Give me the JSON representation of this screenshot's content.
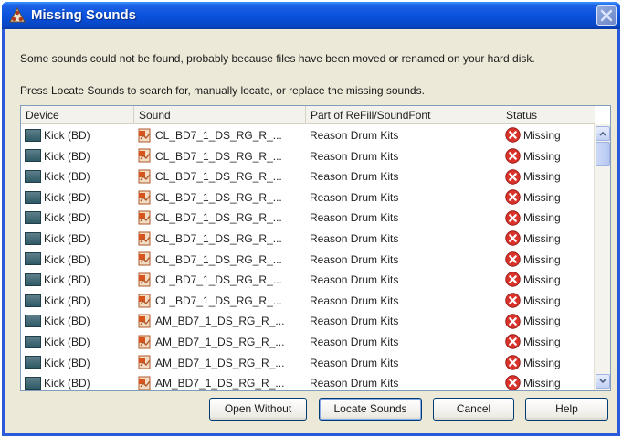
{
  "window": {
    "title": "Missing Sounds"
  },
  "messages": {
    "line1": "Some sounds could not be found, probably because files have been moved or renamed on your hard disk.",
    "line2": "Press Locate Sounds to search for, manually locate, or replace the missing sounds."
  },
  "table": {
    "columns": [
      "Device",
      "Sound",
      "Part of ReFill/SoundFont",
      "Status"
    ],
    "rows": [
      {
        "device": "Kick (BD)",
        "sound": "CL_BD7_1_DS_RG_R_...",
        "part": "Reason Drum Kits",
        "status": "Missing"
      },
      {
        "device": "Kick (BD)",
        "sound": "CL_BD7_1_DS_RG_R_...",
        "part": "Reason Drum Kits",
        "status": "Missing"
      },
      {
        "device": "Kick (BD)",
        "sound": "CL_BD7_1_DS_RG_R_...",
        "part": "Reason Drum Kits",
        "status": "Missing"
      },
      {
        "device": "Kick (BD)",
        "sound": "CL_BD7_1_DS_RG_R_...",
        "part": "Reason Drum Kits",
        "status": "Missing"
      },
      {
        "device": "Kick (BD)",
        "sound": "CL_BD7_1_DS_RG_R_...",
        "part": "Reason Drum Kits",
        "status": "Missing"
      },
      {
        "device": "Kick (BD)",
        "sound": "CL_BD7_1_DS_RG_R_...",
        "part": "Reason Drum Kits",
        "status": "Missing"
      },
      {
        "device": "Kick (BD)",
        "sound": "CL_BD7_1_DS_RG_R_...",
        "part": "Reason Drum Kits",
        "status": "Missing"
      },
      {
        "device": "Kick (BD)",
        "sound": "CL_BD7_1_DS_RG_R_...",
        "part": "Reason Drum Kits",
        "status": "Missing"
      },
      {
        "device": "Kick (BD)",
        "sound": "CL_BD7_1_DS_RG_R_...",
        "part": "Reason Drum Kits",
        "status": "Missing"
      },
      {
        "device": "Kick (BD)",
        "sound": "AM_BD7_1_DS_RG_R_...",
        "part": "Reason Drum Kits",
        "status": "Missing"
      },
      {
        "device": "Kick (BD)",
        "sound": "AM_BD7_1_DS_RG_R_...",
        "part": "Reason Drum Kits",
        "status": "Missing"
      },
      {
        "device": "Kick (BD)",
        "sound": "AM_BD7_1_DS_RG_R_...",
        "part": "Reason Drum Kits",
        "status": "Missing"
      },
      {
        "device": "Kick (BD)",
        "sound": "AM_BD7_1_DS_RG_R_...",
        "part": "Reason Drum Kits",
        "status": "Missing"
      }
    ]
  },
  "buttons": {
    "open_without": "Open Without",
    "locate_sounds": "Locate Sounds",
    "cancel": "Cancel",
    "help": "Help"
  },
  "icons": {
    "title": "reason-logo-icon",
    "close": "close-icon",
    "device": "device-icon",
    "sound": "sound-file-icon",
    "status": "error-icon"
  },
  "colors": {
    "titlebar": "#0a52dd",
    "error": "#d8322a"
  }
}
